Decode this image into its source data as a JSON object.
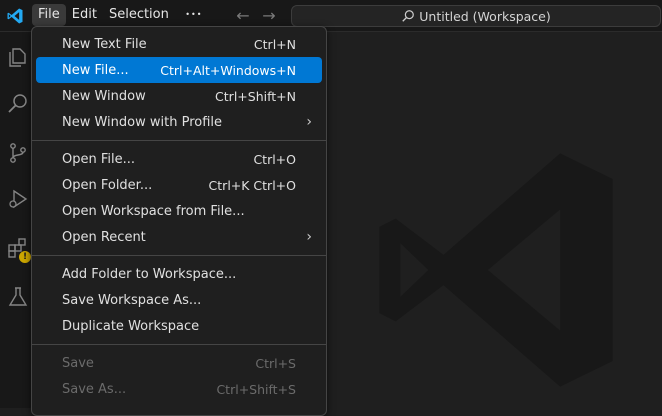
{
  "titlebar": {
    "menus": [
      {
        "label": "File",
        "active": true
      },
      {
        "label": "Edit",
        "active": false
      },
      {
        "label": "Selection",
        "active": false
      }
    ],
    "more_label": "•••",
    "back_arrow": "←",
    "forward_arrow": "→",
    "command_center_label": "Untitled (Workspace)"
  },
  "activity_bar": {
    "icons": [
      "explorer-icon",
      "search-icon",
      "source-control-icon",
      "run-debug-icon",
      "extensions-icon",
      "testing-icon"
    ],
    "warning_badge": "!"
  },
  "file_menu": {
    "groups": [
      [
        {
          "label": "New Text File",
          "shortcut": "Ctrl+N"
        },
        {
          "label": "New File...",
          "shortcut": "Ctrl+Alt+Windows+N",
          "highlight": true
        },
        {
          "label": "New Window",
          "shortcut": "Ctrl+Shift+N"
        },
        {
          "label": "New Window with Profile",
          "submenu": true
        }
      ],
      [
        {
          "label": "Open File...",
          "shortcut": "Ctrl+O"
        },
        {
          "label": "Open Folder...",
          "shortcut": "Ctrl+K Ctrl+O"
        },
        {
          "label": "Open Workspace from File..."
        },
        {
          "label": "Open Recent",
          "submenu": true
        }
      ],
      [
        {
          "label": "Add Folder to Workspace..."
        },
        {
          "label": "Save Workspace As..."
        },
        {
          "label": "Duplicate Workspace"
        }
      ],
      [
        {
          "label": "Save",
          "shortcut": "Ctrl+S",
          "disabled": true
        },
        {
          "label": "Save As...",
          "shortcut": "Ctrl+Shift+S",
          "disabled": true
        }
      ]
    ],
    "submenu_chevron": "›"
  },
  "colors": {
    "accent": "#0078d4",
    "vscode_blue": "#23a9f2",
    "warning": "#cca700"
  }
}
